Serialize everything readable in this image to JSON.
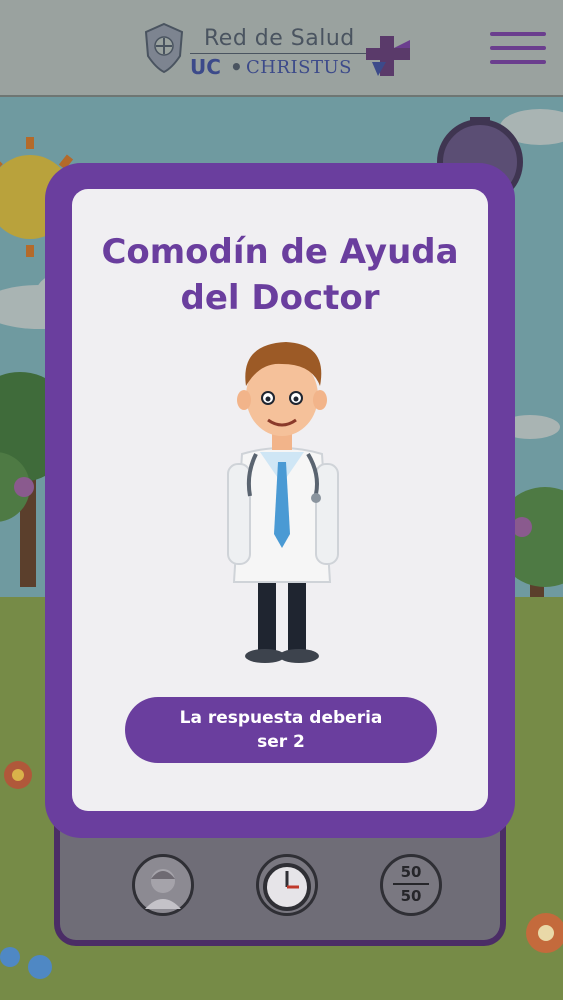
{
  "header": {
    "logo_line1": "Red de Salud",
    "logo_uc": "UC",
    "logo_separator": "•",
    "logo_christus": "CHRISTUS",
    "menu_icon": "hamburger-menu-icon"
  },
  "modal": {
    "title": "Comodín de Ayuda del Doctor",
    "answer": "La respuesta deberia\nser 2",
    "illustration": "doctor-icon"
  },
  "lifelines": {
    "doctor_icon": "doctor-avatar-icon",
    "timer_icon": "stopwatch-icon",
    "fifty_top": "50",
    "fifty_bottom": "50"
  },
  "colors": {
    "brand_purple": "#6a3e9e",
    "card": "#f0eff2",
    "logo_blue": "#3c4a8a"
  }
}
